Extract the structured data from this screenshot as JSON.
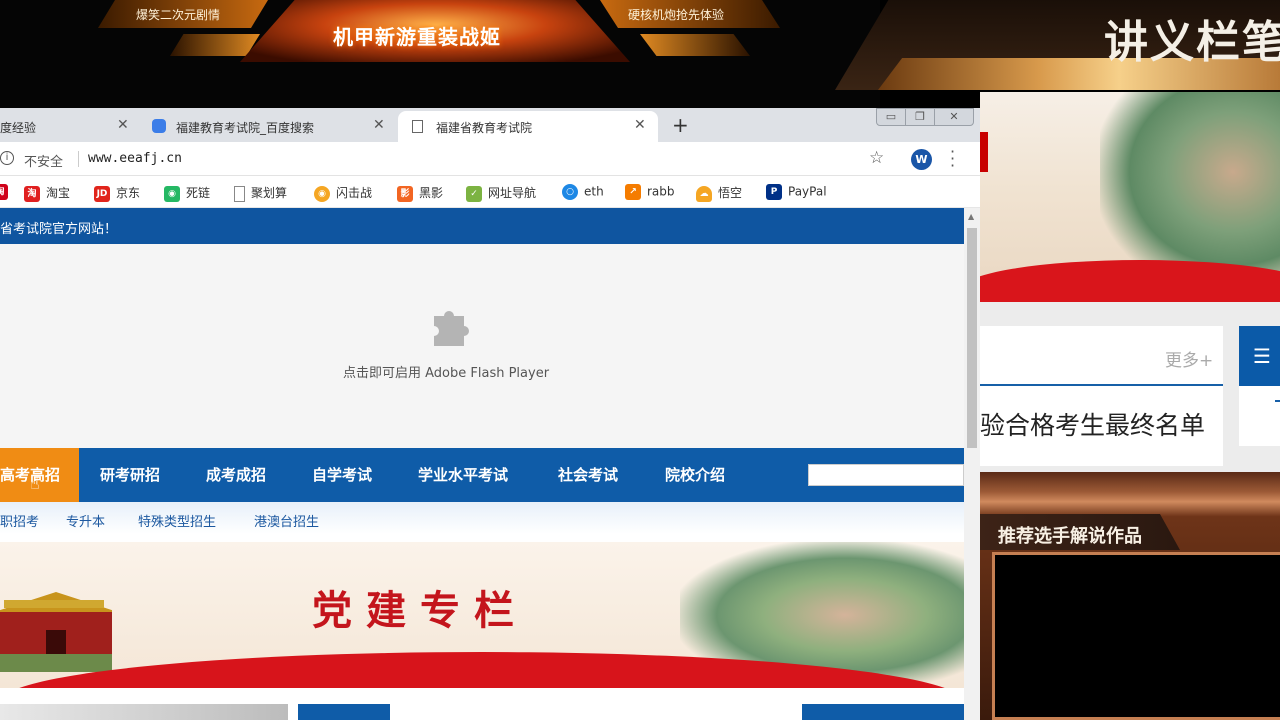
{
  "banner": {
    "left_text": "爆笑二次元剧情",
    "center_text": "机甲新游重装战姬",
    "right_text": "硬核机炮抢先体验"
  },
  "stream_overlay": {
    "title": "讲义栏笔",
    "more_label": "更多+",
    "news_headline": "验合格考生最终名单",
    "recommend_label": "推荐选手解说作品"
  },
  "browser": {
    "tabs": [
      {
        "title": "度经验",
        "active": false
      },
      {
        "title": "福建教育考试院_百度搜索",
        "active": false
      },
      {
        "title": "福建省教育考试院",
        "active": true
      }
    ],
    "new_tab": "+",
    "window_controls": {
      "minimize": "▭",
      "maximize": "❐",
      "close": "✕"
    },
    "address": {
      "security": "不安全",
      "url": "www.eeafj.cn",
      "profile_initial": "W"
    },
    "bookmarks": [
      {
        "label": "",
        "icon": "app-icon",
        "color": "#d0021b"
      },
      {
        "label": "淘宝",
        "icon": "taobao-icon",
        "color": "#ff5000"
      },
      {
        "label": "京东",
        "icon": "jd-icon",
        "color": "#e1251b"
      },
      {
        "label": "死链",
        "icon": "green-chat-icon",
        "color": "#25b864"
      },
      {
        "label": "聚划算",
        "icon": "page-icon",
        "color": "#ffffff"
      },
      {
        "label": "闪击战",
        "icon": "orange-circle-icon",
        "color": "#f5a623"
      },
      {
        "label": "黑影",
        "icon": "orange-square-icon",
        "color": "#f26522"
      },
      {
        "label": "网址导航",
        "icon": "check-icon",
        "color": "#7cb342"
      },
      {
        "label": "eth",
        "icon": "blue-ring-icon",
        "color": "#1e88e5"
      },
      {
        "label": "rabb",
        "icon": "orange-arrow-icon",
        "color": "#f57c00"
      },
      {
        "label": "悟空",
        "icon": "yellow-cloud-icon",
        "color": "#f5a623"
      },
      {
        "label": "PayPal",
        "icon": "paypal-icon",
        "color": "#003087"
      }
    ]
  },
  "site": {
    "top_strip": "省考试院官方网站！",
    "flash_message": "点击即可启用 Adobe Flash Player",
    "main_nav": [
      {
        "label": "高考高招",
        "active": true
      },
      {
        "label": "研考研招",
        "active": false
      },
      {
        "label": "成考成招",
        "active": false
      },
      {
        "label": "自学考试",
        "active": false
      },
      {
        "label": "学业水平考试",
        "active": false
      },
      {
        "label": "社会考试",
        "active": false
      },
      {
        "label": "院校介绍",
        "active": false
      }
    ],
    "sub_nav": [
      "职招考",
      "专升本",
      "特殊类型招生",
      "港澳台招生"
    ],
    "party_title": "党建专栏"
  },
  "colors": {
    "site_blue": "#0f5ca8",
    "active_orange": "#f08c14",
    "party_red": "#c4151c"
  }
}
